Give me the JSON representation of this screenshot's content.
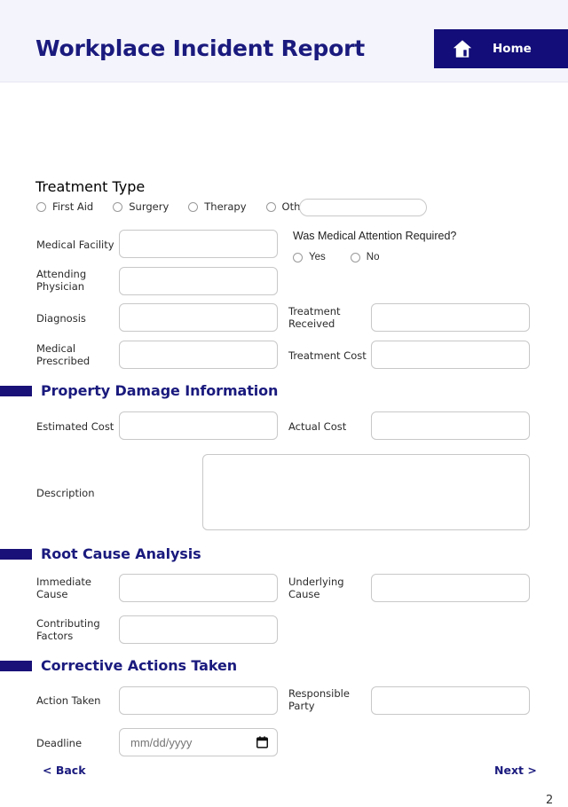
{
  "header": {
    "title": "Workplace Incident Report",
    "home_label": "Home",
    "home_icon": "house-icon",
    "bg_color": "#f4f4fc",
    "accent_color": "#120d78"
  },
  "medical_section": {
    "treatment_type_label": "Treatment Type",
    "treatment_options": [
      {
        "label": "First Aid",
        "selected": false
      },
      {
        "label": "Surgery",
        "selected": false
      },
      {
        "label": "Therapy",
        "selected": false
      },
      {
        "label": "Other:",
        "selected": false
      }
    ],
    "other_input": {
      "value": "",
      "placeholder": ""
    },
    "fields": [
      {
        "label": "Medical Facility",
        "value": "",
        "placeholder": ""
      },
      {
        "label": "Attending Physician",
        "value": "",
        "placeholder": ""
      },
      {
        "label": "Diagnosis",
        "value": "",
        "placeholder": ""
      },
      {
        "label": "Medical Prescribed",
        "value": "",
        "placeholder": ""
      },
      {
        "label": "Treatment Received",
        "value": "",
        "placeholder": ""
      },
      {
        "label": "Treatment Cost",
        "value": "",
        "placeholder": ""
      }
    ],
    "attention_question": "Was Medical Attention Required?",
    "attention_options": [
      {
        "label": "Yes",
        "selected": false
      },
      {
        "label": "No",
        "selected": false
      }
    ]
  },
  "property_section": {
    "title": "Property Damage Information",
    "fields": [
      {
        "label": "Estimated Cost",
        "value": "",
        "placeholder": ""
      },
      {
        "label": "Actual Cost",
        "value": "",
        "placeholder": ""
      },
      {
        "label": "Description",
        "value": "",
        "placeholder": ""
      }
    ]
  },
  "root_cause_section": {
    "title": "Root Cause Analysis",
    "fields": [
      {
        "label": "Immediate Cause",
        "value": "",
        "placeholder": ""
      },
      {
        "label": "Underlying Cause",
        "value": "",
        "placeholder": ""
      },
      {
        "label": "Contributing Factors",
        "value": "",
        "placeholder": ""
      }
    ]
  },
  "corrective_section": {
    "title": "Corrective Actions Taken",
    "fields": [
      {
        "label": "Action Taken",
        "value": "",
        "placeholder": ""
      },
      {
        "label": "Responsible Party",
        "value": "",
        "placeholder": ""
      },
      {
        "label": "Deadline",
        "value": "",
        "placeholder": "mm/dd/yyyy"
      }
    ]
  },
  "footer": {
    "back_label": "< Back",
    "next_label": "Next >",
    "page_number": "2"
  }
}
